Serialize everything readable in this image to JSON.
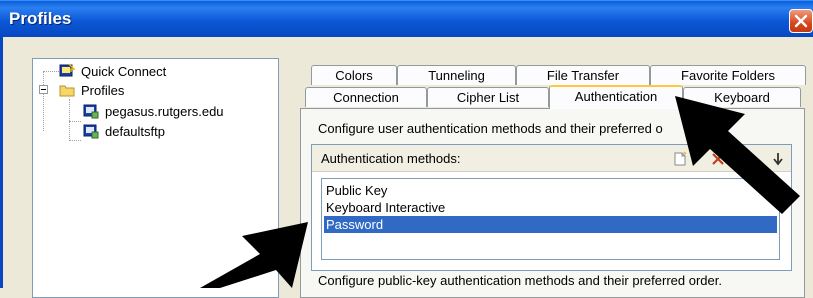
{
  "window": {
    "title": "Profiles",
    "close_icon": "close-icon"
  },
  "tree": {
    "items": [
      {
        "label": "Quick Connect",
        "icon": "quick-connect-icon"
      },
      {
        "label": "Profiles",
        "icon": "folder-icon",
        "expanded": true
      },
      {
        "label": "pegasus.rutgers.edu",
        "icon": "profile-icon"
      },
      {
        "label": "defaultsftp",
        "icon": "profile-icon"
      }
    ]
  },
  "tabs": {
    "row1": [
      "Colors",
      "Tunneling",
      "File Transfer",
      "Favorite Folders"
    ],
    "row2": [
      "Connection",
      "Cipher List",
      "Authentication",
      "Keyboard"
    ],
    "active": "Authentication"
  },
  "panel": {
    "description": "Configure user authentication methods and their preferred o",
    "group_label": "Authentication methods:",
    "methods": [
      "Public Key",
      "Keyboard Interactive",
      "Password"
    ],
    "selected_method": "Password",
    "description2": "Configure public-key authentication methods and their preferred order."
  },
  "colors": {
    "accent": "#0747c0",
    "selection": "#316ac5",
    "tab_highlight": "#ffc83c"
  }
}
